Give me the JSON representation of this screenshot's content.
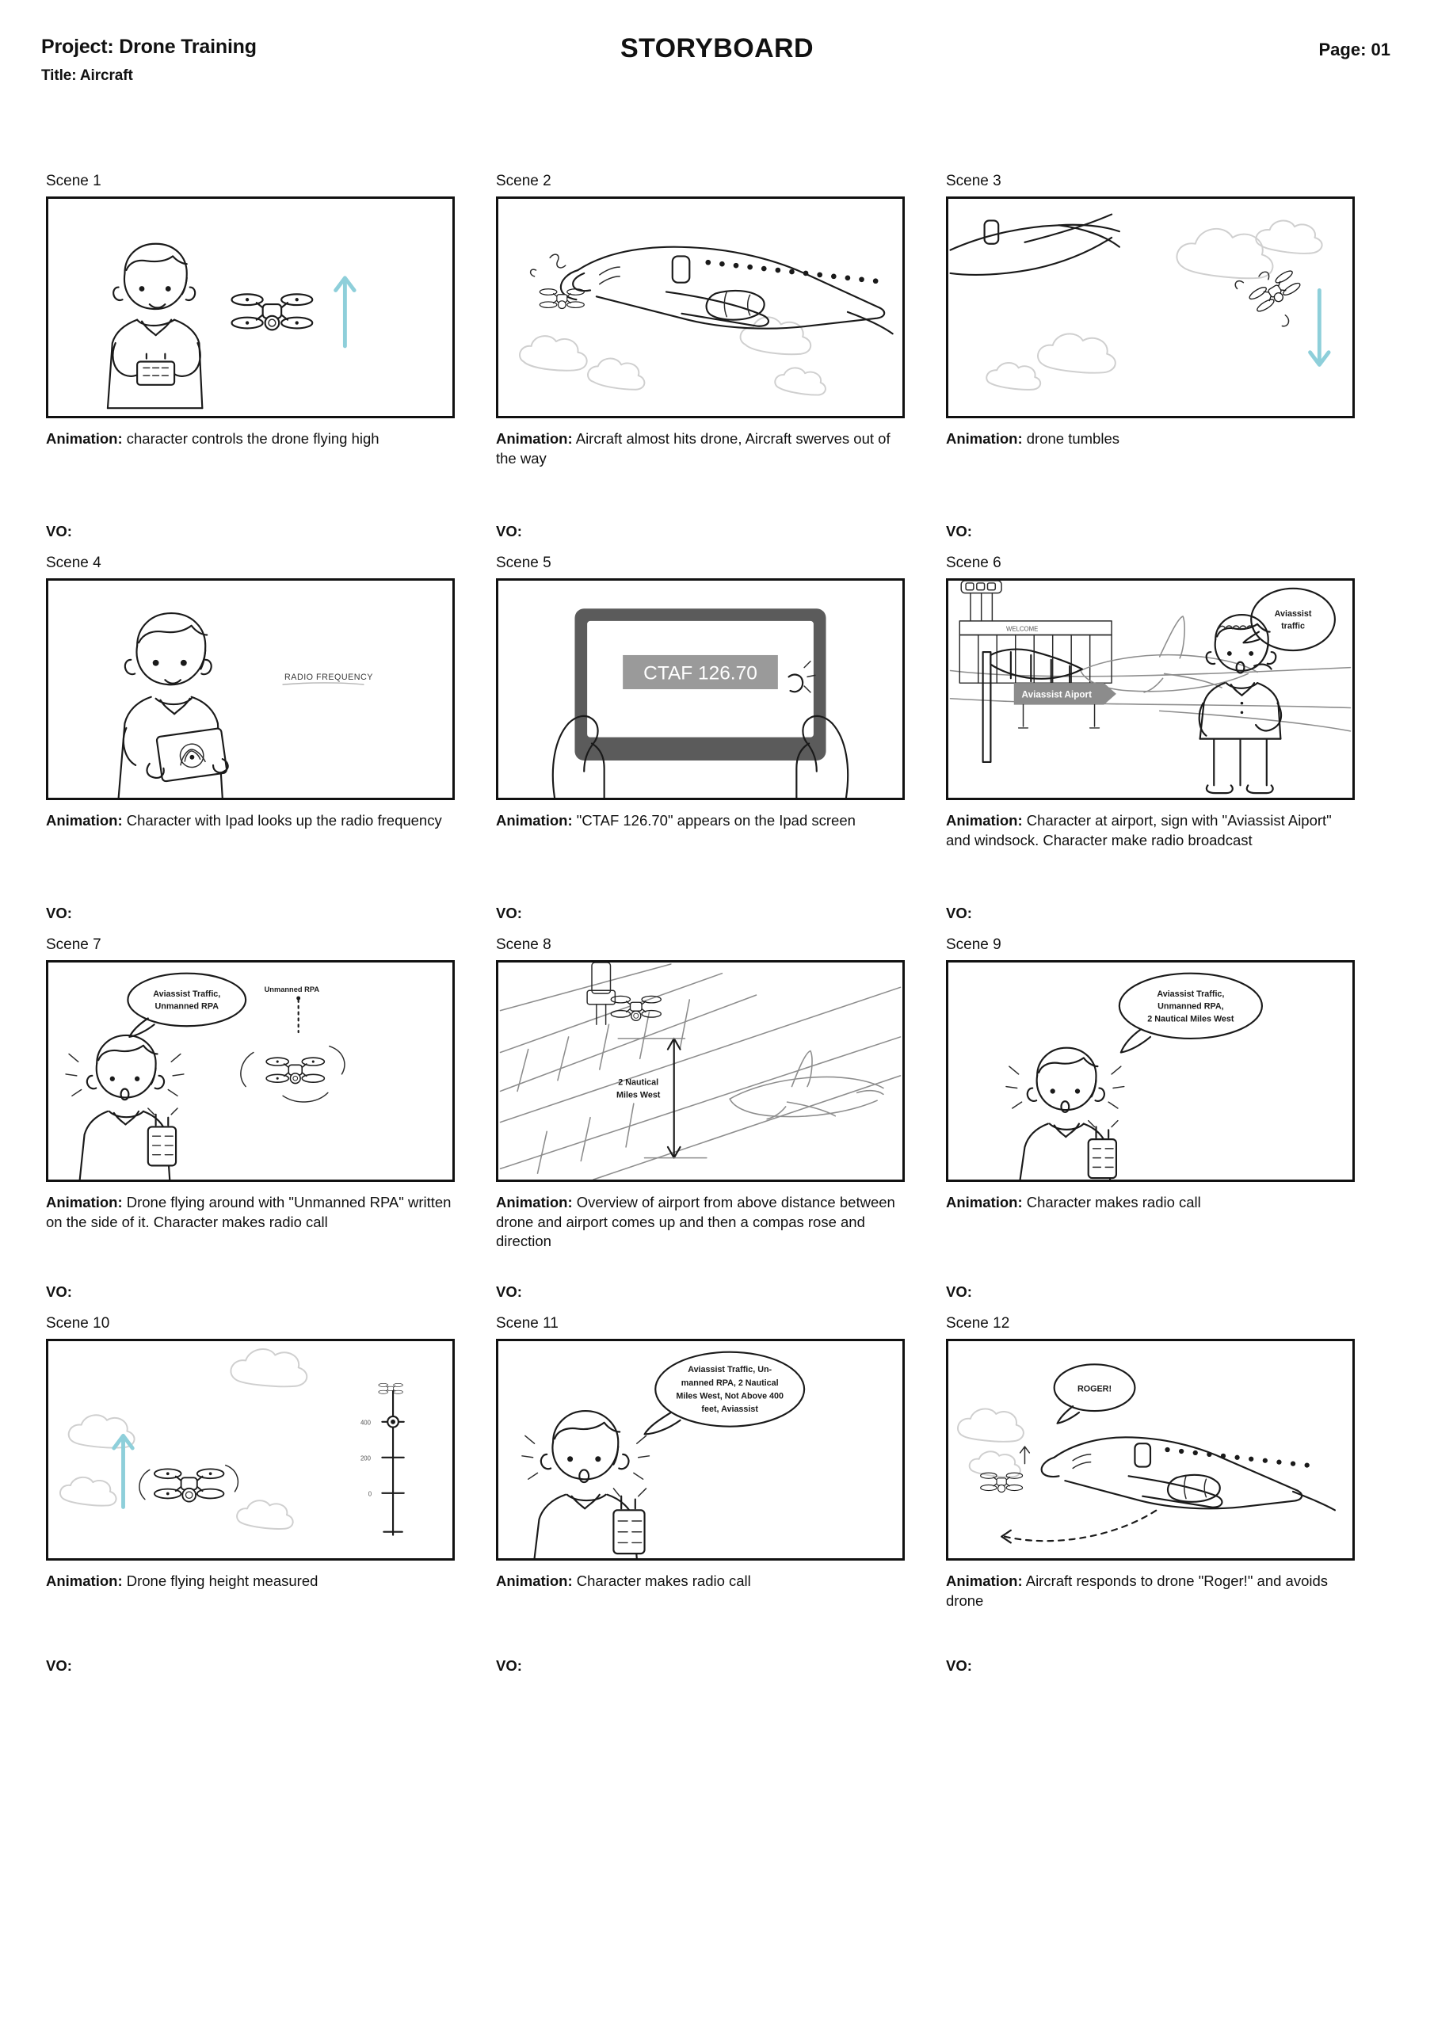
{
  "header": {
    "project": "Project: Drone Training",
    "title": "Title: Aircraft",
    "doc_title": "STORYBOARD",
    "page": "Page: 01"
  },
  "labels": {
    "animation_prefix": "Animation:",
    "vo_prefix": "VO:"
  },
  "scenes": [
    {
      "label": "Scene 1",
      "animation_bold": "Animation:",
      "animation": " character controls the drone flying high",
      "vo": "VO:",
      "art_texts": []
    },
    {
      "label": "Scene 2",
      "animation_bold": "Animation:",
      "animation": " Aircraft almost hits drone, Aircraft swerves out of the way",
      "vo": "VO:",
      "art_texts": []
    },
    {
      "label": "Scene 3",
      "animation_bold": "Animation:",
      "animation": "  drone tumbles",
      "vo": "VO:",
      "art_texts": []
    },
    {
      "label": "Scene 4",
      "animation_bold": "Animation:",
      "animation": " Character with Ipad looks up the radio frequency",
      "vo": "VO:",
      "art_texts": [
        "RADIO FREQUENCY"
      ]
    },
    {
      "label": "Scene 5",
      "animation_bold": "Animation:",
      "animation": " \"CTAF 126.70\" appears on the Ipad screen",
      "vo": "VO:",
      "art_texts": [
        "CTAF 126.70"
      ]
    },
    {
      "label": "Scene 6",
      "animation_bold": "Animation:",
      "animation": " Character at airport, sign with \"Aviassist Aiport\" and windsock. Character make radio broadcast",
      "vo": "VO:",
      "art_texts": [
        "WELCOME",
        "Aviassist Aiport",
        "Aviassist traffic"
      ]
    },
    {
      "label": "Scene 7",
      "animation_bold": "Animation:",
      "animation": " Drone flying around with \"Unmanned RPA\" written on the side of it. Character makes radio call",
      "vo": "VO:",
      "art_texts": [
        "Aviassist Traffic,",
        "Unmanned RPA",
        "Unmanned RPA"
      ]
    },
    {
      "label": "Scene 8",
      "animation_bold": "Animation:",
      "animation": " Overview of airport from above distance between drone and airport comes up and then a compas rose and direction",
      "vo": "VO:",
      "art_texts": [
        "2 Nautical",
        "Miles West"
      ]
    },
    {
      "label": "Scene 9",
      "animation_bold": "Animation:",
      "animation": " Character makes radio call",
      "vo": "VO:",
      "art_texts": [
        "Aviassist Traffic,",
        "Unmanned RPA,",
        "2 Nautical Miles West"
      ]
    },
    {
      "label": "Scene 10",
      "animation_bold": "Animation:",
      "animation": " Drone flying height measured",
      "vo": "VO:",
      "art_texts": [
        "400",
        "200",
        "0"
      ]
    },
    {
      "label": "Scene 11",
      "animation_bold": "Animation:",
      "animation": " Character makes radio call",
      "vo": "VO:",
      "art_texts": [
        "Aviassist Traffic, Un-",
        "manned RPA, 2 Nautical",
        "Miles West, Not Above 400",
        "feet, Aviassist"
      ]
    },
    {
      "label": "Scene 12",
      "animation_bold": "Animation:",
      "animation": " Aircraft responds to drone \"Roger!\" and avoids drone",
      "vo": "VO:",
      "art_texts": [
        "ROGER!"
      ]
    }
  ],
  "art": {
    "s4_label": "RADIO FREQUENCY",
    "s5_screen": "CTAF 126.70",
    "s6_welcome": "WELCOME",
    "s6_sign": "Aviassist Aiport",
    "s6_bubble_l1": "Aviassist",
    "s6_bubble_l2": "traffic",
    "s7_bubble_l1": "Aviassist Traffic,",
    "s7_bubble_l2": "Unmanned RPA",
    "s7_callout": "Unmanned RPA",
    "s8_l1": "2 Nautical",
    "s8_l2": "Miles West",
    "s9_l1": "Aviassist Traffic,",
    "s9_l2": "Unmanned RPA,",
    "s9_l3": "2 Nautical Miles West",
    "s10_t1": "400",
    "s10_t2": "200",
    "s10_t3": "0",
    "s11_l1": "Aviassist Traffic, Un-",
    "s11_l2": "manned RPA, 2 Nautical",
    "s11_l3": "Miles West, Not Above 400",
    "s11_l4": "feet, Aviassist",
    "s12_roger": "ROGER!"
  },
  "colors": {
    "ink": "#1a1a1a",
    "arrow_blue": "#8ecfda",
    "sign_gray": "#8c8c8c",
    "screen_gray": "#9a9a9a",
    "cloud_gray": "#d9d9d9"
  }
}
